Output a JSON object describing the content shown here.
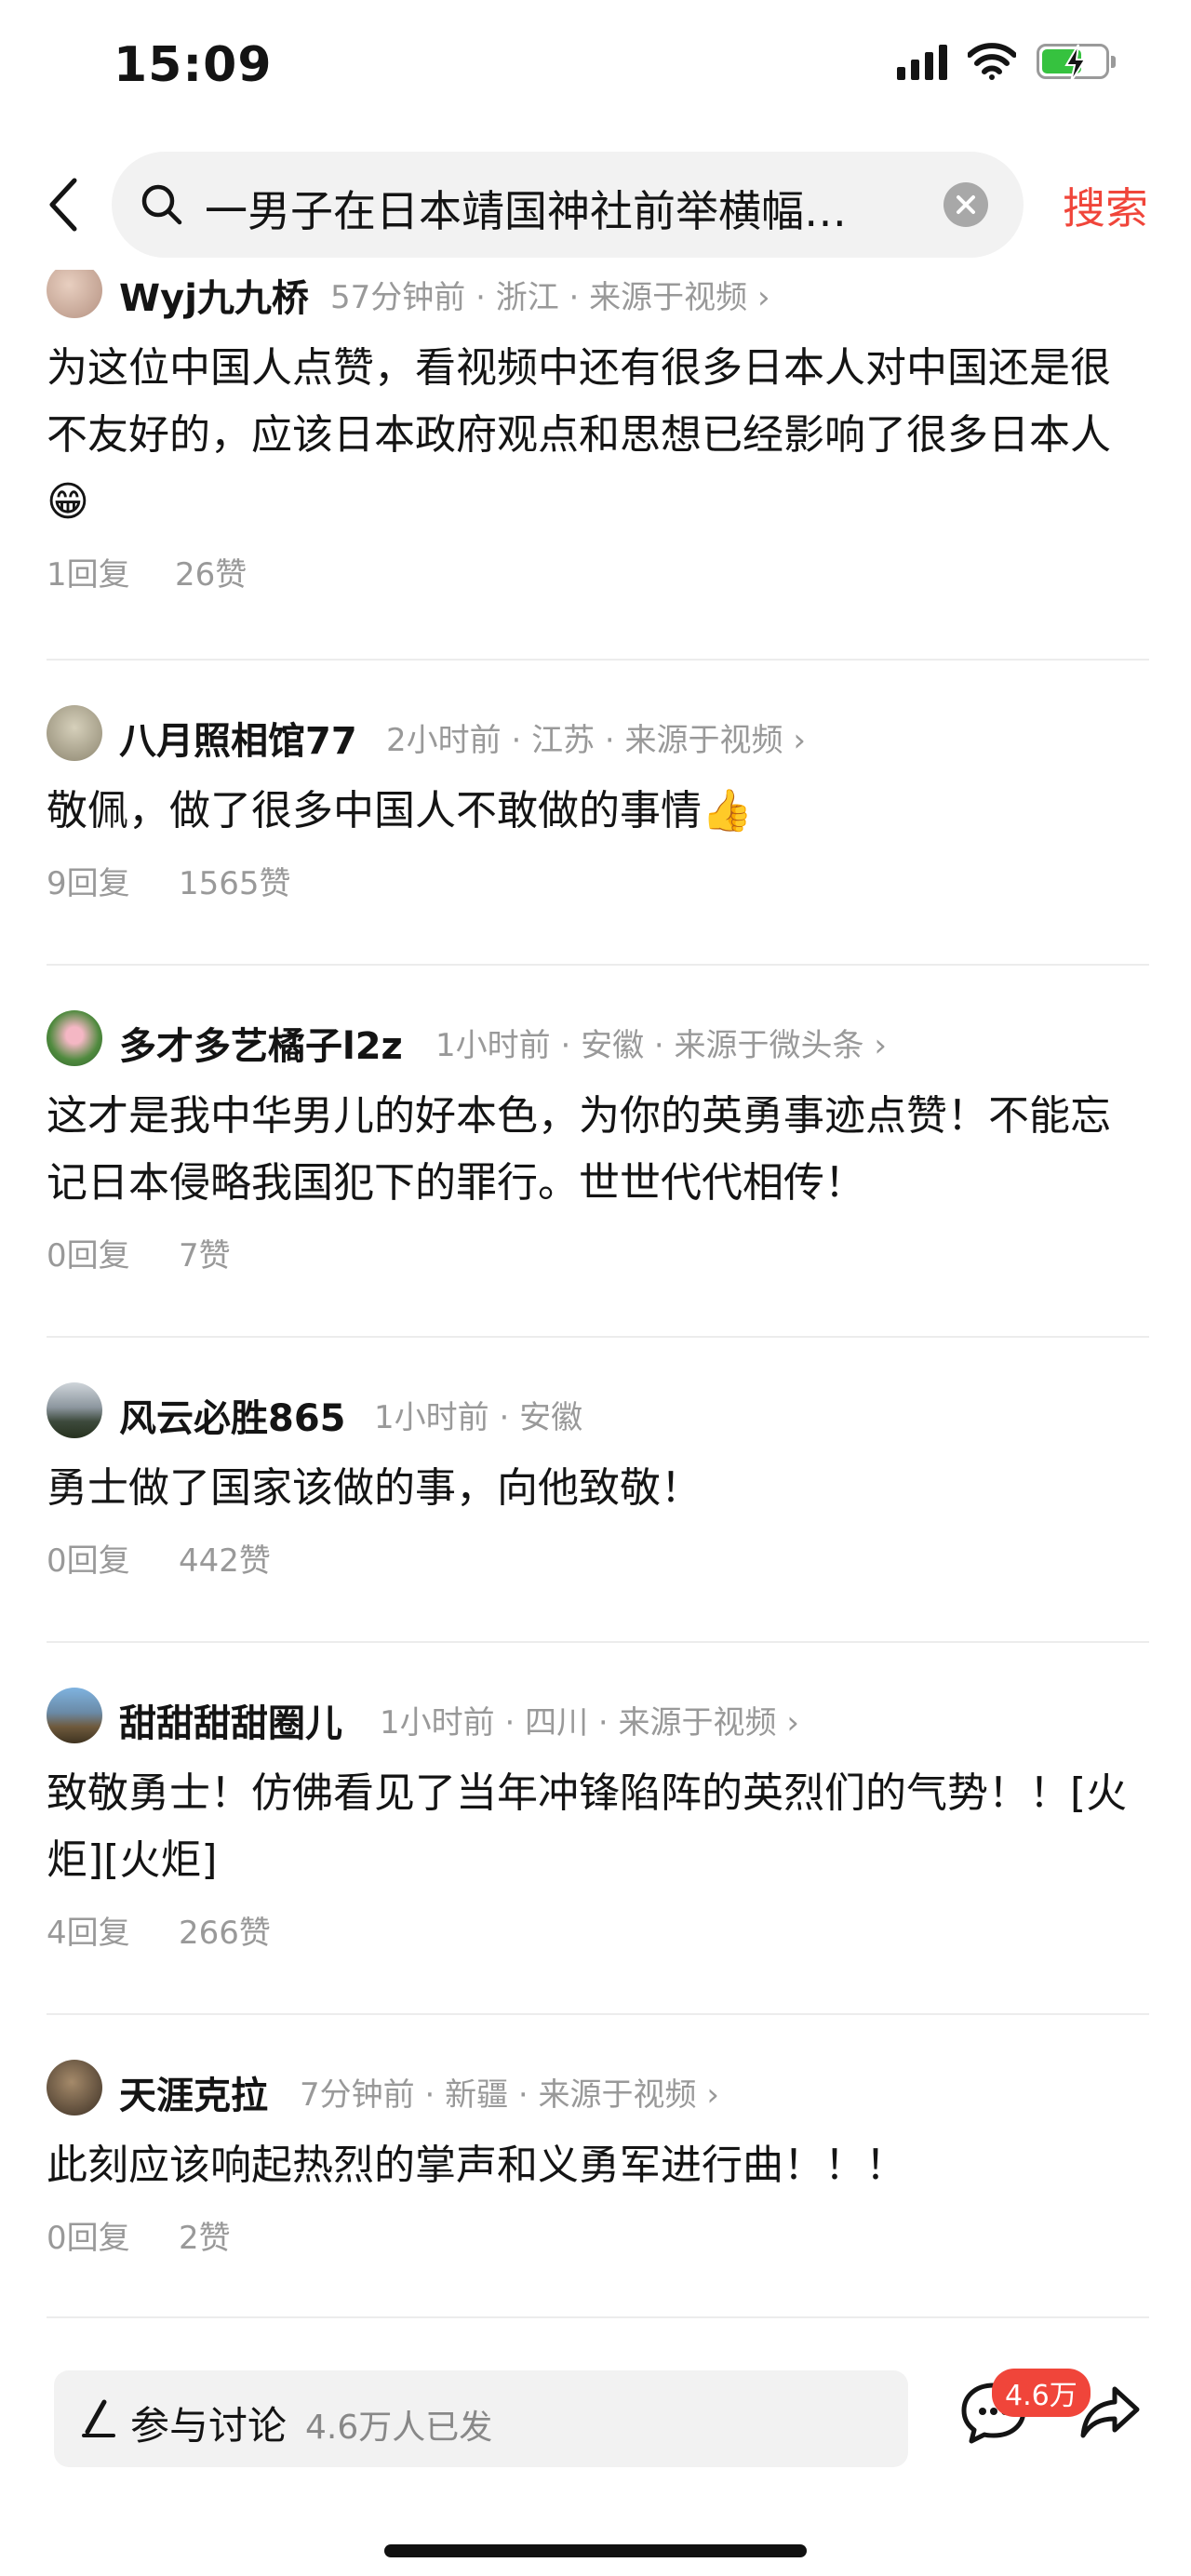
{
  "status_bar": {
    "time": "15:09"
  },
  "search": {
    "query": "一男子在日本靖国神社前举横幅…",
    "button_label": "搜索"
  },
  "comments": [
    {
      "username": "Wyj九九桥",
      "time": "57分钟前",
      "location": "浙江",
      "source": "来源于视频",
      "body": "为这位中国人点赞，看视频中还有很多日本人对中国还是很不友好的，应该日本政府观点和思想已经影响了很多日本人😁",
      "replies": "1回复",
      "likes": "26赞"
    },
    {
      "username": "八月照相馆77",
      "time": "2小时前",
      "location": "江苏",
      "source": "来源于视频",
      "body": "敬佩，做了很多中国人不敢做的事情👍",
      "replies": "9回复",
      "likes": "1565赞"
    },
    {
      "username": "多才多艺橘子l2z",
      "time": "1小时前",
      "location": "安徽",
      "source": "来源于微头条",
      "body": "这才是我中华男儿的好本色，为你的英勇事迹点赞！不能忘记日本侵略我国犯下的罪行。世世代代相传！",
      "replies": "0回复",
      "likes": "7赞"
    },
    {
      "username": "风云必胜865",
      "time": "1小时前",
      "location": "安徽",
      "source": "",
      "body": "勇士做了国家该做的事，向他致敬！",
      "replies": "0回复",
      "likes": "442赞"
    },
    {
      "username": "甜甜甜甜圈儿",
      "time": "1小时前",
      "location": "四川",
      "source": "来源于视频",
      "body": "致敬勇士！仿佛看见了当年冲锋陷阵的英烈们的气势！！[火炬][火炬]",
      "replies": "4回复",
      "likes": "266赞"
    },
    {
      "username": "天涯克拉",
      "time": "7分钟前",
      "location": "新疆",
      "source": "来源于视频",
      "body": "此刻应该响起热烈的掌声和义勇军进行曲！！！",
      "replies": "0回复",
      "likes": "2赞"
    }
  ],
  "bottom_bar": {
    "discuss_label": "参与讨论",
    "discuss_count": "4.6万人已发",
    "comment_badge": "4.6万"
  },
  "colors": {
    "accent": "#f0453a",
    "meta_gray": "#999999",
    "battery_green": "#36c23f"
  },
  "icons": [
    "back-arrow-icon",
    "search-icon",
    "clear-icon",
    "pen-icon",
    "comment-bubble-icon",
    "share-arrow-icon",
    "signal-icon",
    "wifi-icon",
    "battery-icon"
  ]
}
